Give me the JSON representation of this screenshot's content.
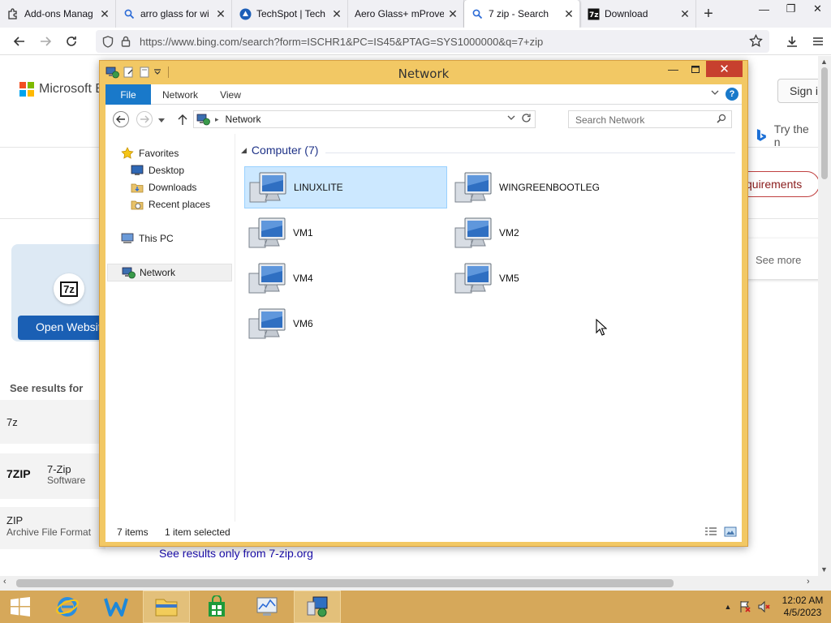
{
  "browser": {
    "tabs": [
      {
        "label": "Add-ons Manag",
        "icon": "puzzle-icon",
        "active": false
      },
      {
        "label": "arro glass for wi",
        "icon": "search-icon",
        "active": false
      },
      {
        "label": "TechSpot | Tech",
        "icon": "techspot-icon",
        "active": false
      },
      {
        "label": "Aero Glass+ mProve",
        "icon": "",
        "active": false
      },
      {
        "label": "7 zip - Search",
        "icon": "search-icon",
        "active": true
      },
      {
        "label": "Download",
        "icon": "7zip-icon",
        "active": false
      }
    ],
    "url": "https://www.bing.com/search?form=ISCHR1&PC=IS45&PTAG=SYS1000000&q=7+zip"
  },
  "bing": {
    "logo_text": "Microsoft Bi",
    "signin": "Sign i",
    "try_text": "Try the n",
    "requirements_btn": "quirements",
    "see_more": "See more",
    "open_website": "Open Websit",
    "see_results_for": "See results for",
    "side_items": [
      {
        "label": "7z",
        "sub": ""
      },
      {
        "label": "7-Zip",
        "sub": "Software"
      },
      {
        "label": "ZIP",
        "sub": "Archive File Format"
      }
    ],
    "only_from": "See results only from 7-zip.org"
  },
  "explorer": {
    "title": "Network",
    "ribbon_tabs": [
      "File",
      "Network",
      "View"
    ],
    "address_crumb": "Network",
    "search_placeholder": "Search Network",
    "nav": {
      "favorites": "Favorites",
      "desktop": "Desktop",
      "downloads": "Downloads",
      "recent": "Recent places",
      "this_pc": "This PC",
      "network": "Network"
    },
    "group_header": "Computer (7)",
    "computers": [
      "LINUXLITE",
      "WINGREENBOOTLEG",
      "VM1",
      "VM2",
      "VM4",
      "VM5",
      "VM6"
    ],
    "status_items": "7 items",
    "status_selected": "1 item selected"
  },
  "taskbar": {
    "time": "12:02 AM",
    "date": "4/5/2023"
  },
  "colors": {
    "explorer_frame": "#f2c864",
    "close_button": "#c7402e",
    "file_tab": "#1979ca",
    "selection": "#cce8ff",
    "taskbar": "#d6a85a"
  }
}
